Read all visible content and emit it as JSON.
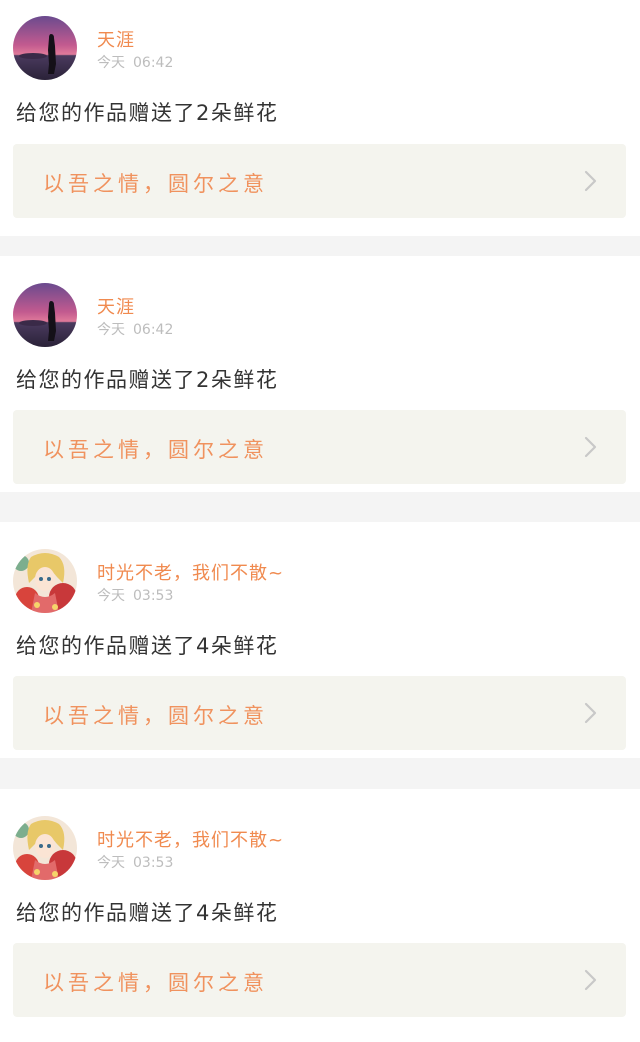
{
  "notifications": [
    {
      "username": "天涯",
      "day": "今天",
      "time": "06:42",
      "message": "给您的作品赠送了2朵鲜花",
      "gift_text": "以吾之情，圆尔之意",
      "avatar_icon": "sunset-silhouette-avatar"
    },
    {
      "username": "天涯",
      "day": "今天",
      "time": "06:42",
      "message": "给您的作品赠送了2朵鲜花",
      "gift_text": "以吾之情，圆尔之意",
      "avatar_icon": "sunset-silhouette-avatar"
    },
    {
      "username": "时光不老，我们不散~",
      "day": "今天",
      "time": "03:53",
      "message": "给您的作品赠送了4朵鲜花",
      "gift_text": "以吾之情，圆尔之意",
      "avatar_icon": "anime-girl-avatar"
    },
    {
      "username": "时光不老，我们不散~",
      "day": "今天",
      "time": "03:53",
      "message": "给您的作品赠送了4朵鲜花",
      "gift_text": "以吾之情，圆尔之意",
      "avatar_icon": "anime-girl-avatar"
    }
  ],
  "colors": {
    "accent": "#f08a4f",
    "gift_banner_bg": "#f4f4ee",
    "separator": "#f4f4f4"
  }
}
